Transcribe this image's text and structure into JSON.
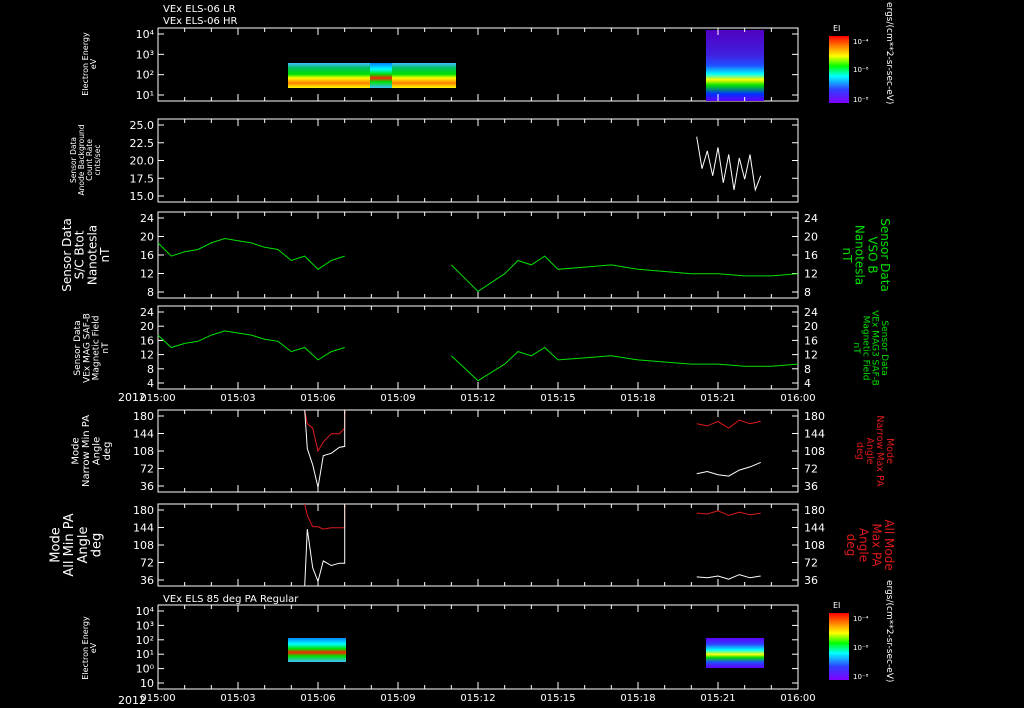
{
  "header": {
    "lines": [
      "VEx ELS-06 LR",
      "VEx ELS-06 HR"
    ],
    "bottom_panel_title": "VEx ELS 85 deg PA Regular",
    "year_label": "2012"
  },
  "colors": {
    "background": "#000000",
    "axis": "#ffffff",
    "green": "#00e000",
    "red": "#dd1a1a",
    "white": "#ffffff"
  },
  "time_axis": {
    "ticks": [
      "015:00",
      "015:03",
      "015:06",
      "015:09",
      "015:12",
      "015:15",
      "015:18",
      "015:21",
      "016:00"
    ]
  },
  "colorbar": {
    "title": "EI",
    "ticks": [
      "10⁻⁴",
      "10⁻⁶",
      "10⁻⁸"
    ],
    "unit": "ergs/(cm**2-sr-sec-eV)"
  },
  "panels": {
    "p1": {
      "left_label": [
        "Electron Energy",
        "eV"
      ],
      "y_ticks": [
        "10⁴",
        "10³",
        "10²",
        "10¹"
      ]
    },
    "p2": {
      "left_label": [
        "Sensor Data",
        "Anode Background",
        "Count Rate",
        "cnts/sec"
      ],
      "y_ticks": [
        "25.0",
        "22.5",
        "20.0",
        "17.5",
        "15.0"
      ]
    },
    "p3": {
      "left_label": [
        "Sensor Data",
        "S/C Btot",
        "Nanotesla",
        "nT"
      ],
      "right_label": [
        "Sensor Data",
        "VSO B",
        "Nanotesla",
        "nT"
      ],
      "y_ticks": [
        "24",
        "20",
        "16",
        "12",
        "8"
      ]
    },
    "p4": {
      "left_label": [
        "Sensor Data",
        "VEx MAG SAF-B",
        "Magnetic Field",
        "nT"
      ],
      "right_label": [
        "Sensor Data",
        "VEx MAG3 SAF-B",
        "Magnetic Field",
        "nT"
      ],
      "y_ticks": [
        "24",
        "20",
        "16",
        "12",
        "8",
        "4"
      ]
    },
    "p5": {
      "left_label": [
        "Mode",
        "Narrow Min PA",
        "Angle",
        "deg"
      ],
      "right_label": [
        "Mode",
        "Narrow Max PA",
        "Angle",
        "deg"
      ],
      "y_ticks": [
        "180",
        "144",
        "108",
        "72",
        "36"
      ]
    },
    "p6": {
      "left_label": [
        "Mode",
        "All Min PA",
        "Angle",
        "deg"
      ],
      "right_label": [
        "All Mode",
        "Max PA",
        "Angle",
        "deg"
      ],
      "y_ticks": [
        "180",
        "144",
        "108",
        "72",
        "36"
      ]
    },
    "p7": {
      "left_label": [
        "Electron Energy",
        "eV"
      ],
      "y_ticks": [
        "10⁴",
        "10³",
        "10²",
        "10¹",
        "10⁰",
        "10"
      ]
    }
  },
  "chart_data": [
    {
      "type": "heatmap",
      "panel": "p1",
      "title": "VEx ELS-06 LR / VEx ELS-06 HR",
      "ylabel": "Electron Energy eV",
      "x_range": [
        "015:00",
        "016:00"
      ],
      "data_intervals": [
        [
          "015:05",
          "015:11"
        ],
        [
          "015:20",
          "015:22"
        ]
      ]
    },
    {
      "type": "line",
      "panel": "p2",
      "ylabel": "Anode Background Count Rate cnts/sec",
      "ylim": [
        13.3,
        25.0
      ],
      "x": [
        20.2,
        20.4,
        20.6,
        20.8,
        21.0,
        21.2,
        21.4,
        21.6,
        21.8,
        22.0,
        22.2,
        22.4,
        22.6
      ],
      "series": [
        {
          "values": [
            22.5,
            18,
            20.5,
            17,
            21,
            16,
            20,
            15,
            19.5,
            16.5,
            20,
            15,
            17
          ]
        }
      ]
    },
    {
      "type": "line",
      "panel": "p3",
      "ylabel": "S/C Btot Nanotesla nT",
      "ylim": [
        4.5,
        24
      ],
      "x": [
        0,
        0.5,
        1,
        1.5,
        2,
        2.5,
        3,
        3.5,
        4,
        4.5,
        5,
        5.5,
        6,
        6.5,
        7,
        11,
        11.5,
        12,
        12.5,
        13,
        13.5,
        14,
        14.5,
        15,
        16,
        17,
        18,
        19,
        20,
        21,
        22,
        23,
        24
      ],
      "series": [
        {
          "values": [
            17,
            14,
            15,
            15.5,
            17,
            18,
            17.5,
            17,
            16,
            15.5,
            13,
            14,
            11,
            13,
            14,
            12,
            9,
            6,
            8,
            10,
            13,
            12,
            14,
            11,
            11.5,
            12,
            11,
            10.5,
            10,
            10,
            9.5,
            9.5,
            10
          ]
        }
      ]
    },
    {
      "type": "line",
      "panel": "p4",
      "ylabel": "VEx MAG SAF-B Magnetic Field nT",
      "ylim": [
        4,
        24
      ],
      "x": [
        0,
        0.5,
        1,
        1.5,
        2,
        2.5,
        3,
        3.5,
        4,
        4.5,
        5,
        5.5,
        6,
        6.5,
        7,
        11,
        11.5,
        12,
        12.5,
        13,
        13.5,
        14,
        14.5,
        15,
        16,
        17,
        18,
        19,
        20,
        21,
        22,
        23,
        24
      ],
      "series": [
        {
          "values": [
            17,
            14,
            15,
            15.5,
            17,
            18,
            17.5,
            17,
            16,
            15.5,
            13,
            14,
            11,
            13,
            14,
            12,
            9,
            6,
            8,
            10,
            13,
            12,
            14,
            11,
            11.5,
            12,
            11,
            10.5,
            10,
            10,
            9.5,
            9.5,
            10
          ]
        }
      ]
    },
    {
      "type": "line",
      "panel": "p5",
      "ylabel": "Narrow Min/Max PA Angle deg",
      "ylim": [
        0,
        180
      ],
      "series": [
        {
          "x": [
            5.5,
            5.6,
            5.8,
            6.0,
            6.2,
            6.5,
            6.8,
            7.0,
            7.0
          ],
          "values": [
            180,
            150,
            140,
            90,
            110,
            128,
            128,
            140,
            180
          ],
          "color": "red"
        },
        {
          "x": [
            5.5,
            5.6,
            5.8,
            6.0,
            6.2,
            6.5,
            6.8,
            7.0,
            7.0
          ],
          "values": [
            180,
            95,
            60,
            10,
            80,
            85,
            98,
            100,
            180
          ],
          "color": "white"
        },
        {
          "x": [
            20.2,
            20.6,
            21.0,
            21.4,
            21.8,
            22.2,
            22.6
          ],
          "values": [
            150,
            145,
            155,
            140,
            158,
            150,
            155
          ],
          "color": "red"
        },
        {
          "x": [
            20.2,
            20.6,
            21.0,
            21.4,
            21.8,
            22.2,
            22.6
          ],
          "values": [
            40,
            45,
            38,
            35,
            48,
            55,
            65
          ],
          "color": "white"
        }
      ]
    },
    {
      "type": "line",
      "panel": "p6",
      "ylabel": "All Min/Max PA Angle deg",
      "ylim": [
        0,
        180
      ],
      "series": [
        {
          "x": [
            5.5,
            5.6,
            5.8,
            6.0,
            6.2,
            6.5,
            6.8,
            7.0,
            7.0
          ],
          "values": [
            180,
            155,
            130,
            130,
            125,
            128,
            128,
            128,
            180
          ],
          "color": "red"
        },
        {
          "x": [
            5.5,
            5.6,
            5.8,
            6.0,
            6.2,
            6.5,
            6.8,
            7.0,
            7.0
          ],
          "values": [
            0,
            125,
            40,
            10,
            55,
            45,
            50,
            50,
            180
          ],
          "color": "white"
        },
        {
          "x": [
            20.2,
            20.6,
            21.0,
            21.4,
            21.8,
            22.2,
            22.6
          ],
          "values": [
            160,
            158,
            165,
            155,
            162,
            156,
            160
          ],
          "color": "red"
        },
        {
          "x": [
            20.2,
            20.6,
            21.0,
            21.4,
            21.8,
            22.2,
            22.6
          ],
          "values": [
            20,
            18,
            22,
            15,
            25,
            18,
            22
          ],
          "color": "white"
        }
      ]
    },
    {
      "type": "heatmap",
      "panel": "p7",
      "title": "VEx ELS 85 deg PA Regular",
      "ylabel": "Electron Energy eV",
      "x_range": [
        "015:00",
        "016:00"
      ],
      "data_intervals": [
        [
          "015:05",
          "015:07"
        ],
        [
          "015:20",
          "015:22"
        ]
      ]
    }
  ]
}
